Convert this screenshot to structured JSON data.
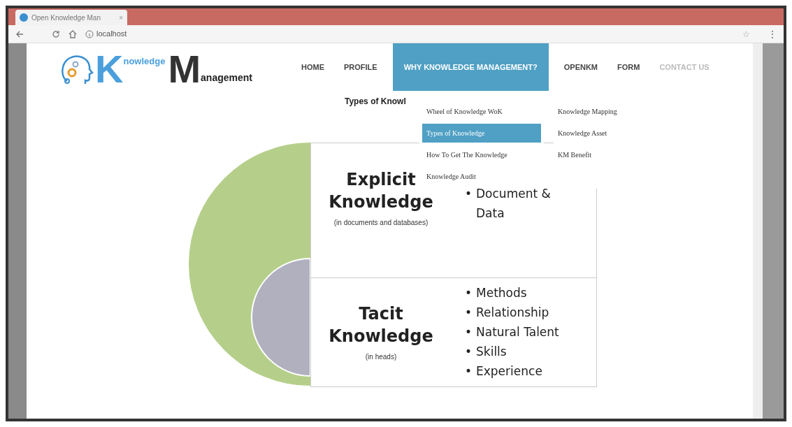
{
  "browser": {
    "tab_title": "Open Knowledge Man",
    "address": "localhost"
  },
  "logo": {
    "k_word": "nowledge",
    "m_word": "anagement",
    "k_letter": "K",
    "m_letter": "M"
  },
  "nav": [
    {
      "label": "HOME",
      "selected": false
    },
    {
      "label": "PROFILE",
      "selected": false
    },
    {
      "label": "WHY KNOWLEDGE MANAGEMENT?",
      "selected": true
    },
    {
      "label": "OPENKM",
      "selected": false
    },
    {
      "label": "FORM",
      "selected": false
    },
    {
      "label": "CONTACT US",
      "selected": false
    }
  ],
  "dropdown": {
    "columns": [
      [
        {
          "label": "Wheel of Knowledge WoK",
          "selected": false
        },
        {
          "label": "Types of Knowledge",
          "selected": true
        },
        {
          "label": "How To Get The Knowledge",
          "selected": false
        },
        {
          "label": "Knowledge Audit",
          "selected": false
        }
      ],
      [
        {
          "label": "Knowledge Mapping",
          "selected": false
        },
        {
          "label": "Knowledge Asset",
          "selected": false
        },
        {
          "label": "KM Benefit",
          "selected": false
        }
      ]
    ]
  },
  "page_heading": "Types of Knowl",
  "browser_icons": {
    "close": "×",
    "star": "☆",
    "menu": "⋮"
  },
  "diagram": [
    {
      "title": [
        "Explicit",
        "Knowledge"
      ],
      "note": "(in documents and databases)",
      "bullet": "•",
      "bullets": [
        "Document & Data"
      ]
    },
    {
      "title": [
        "Tacit",
        "Knowledge"
      ],
      "note": "(in heads)",
      "bullet": "•",
      "bullets": [
        "Methods",
        "Relationship",
        "Natural Talent",
        "Skills",
        "Experience"
      ]
    }
  ]
}
